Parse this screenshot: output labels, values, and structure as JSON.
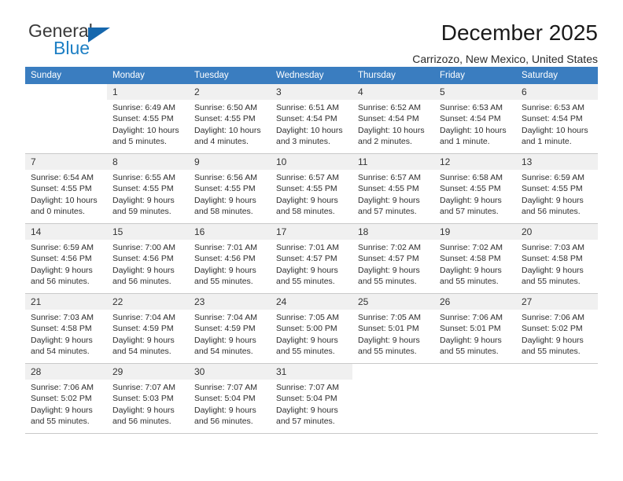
{
  "brand": {
    "name_top": "General",
    "name_bottom": "Blue",
    "triangle_color": "#1567ad",
    "blue_color": "#1d7fc4"
  },
  "header": {
    "title": "December 2025",
    "subtitle": "Carrizozo, New Mexico, United States"
  },
  "theme": {
    "header_row_bg": "#3a7dc0",
    "header_row_text": "#ffffff",
    "daynum_bg": "#f0f0f0",
    "cell_border": "#c9c9c9"
  },
  "weekdays": [
    "Sunday",
    "Monday",
    "Tuesday",
    "Wednesday",
    "Thursday",
    "Friday",
    "Saturday"
  ],
  "labels": {
    "sunrise_prefix": "Sunrise:",
    "sunset_prefix": "Sunset:",
    "daylight_prefix": "Daylight:"
  },
  "weeks": [
    [
      {
        "day": "",
        "sunrise": "",
        "sunset": "",
        "daylight_line1": "",
        "daylight_line2": ""
      },
      {
        "day": "1",
        "sunrise": "Sunrise: 6:49 AM",
        "sunset": "Sunset: 4:55 PM",
        "daylight_line1": "Daylight: 10 hours",
        "daylight_line2": "and 5 minutes."
      },
      {
        "day": "2",
        "sunrise": "Sunrise: 6:50 AM",
        "sunset": "Sunset: 4:55 PM",
        "daylight_line1": "Daylight: 10 hours",
        "daylight_line2": "and 4 minutes."
      },
      {
        "day": "3",
        "sunrise": "Sunrise: 6:51 AM",
        "sunset": "Sunset: 4:54 PM",
        "daylight_line1": "Daylight: 10 hours",
        "daylight_line2": "and 3 minutes."
      },
      {
        "day": "4",
        "sunrise": "Sunrise: 6:52 AM",
        "sunset": "Sunset: 4:54 PM",
        "daylight_line1": "Daylight: 10 hours",
        "daylight_line2": "and 2 minutes."
      },
      {
        "day": "5",
        "sunrise": "Sunrise: 6:53 AM",
        "sunset": "Sunset: 4:54 PM",
        "daylight_line1": "Daylight: 10 hours",
        "daylight_line2": "and 1 minute."
      },
      {
        "day": "6",
        "sunrise": "Sunrise: 6:53 AM",
        "sunset": "Sunset: 4:54 PM",
        "daylight_line1": "Daylight: 10 hours",
        "daylight_line2": "and 1 minute."
      }
    ],
    [
      {
        "day": "7",
        "sunrise": "Sunrise: 6:54 AM",
        "sunset": "Sunset: 4:55 PM",
        "daylight_line1": "Daylight: 10 hours",
        "daylight_line2": "and 0 minutes."
      },
      {
        "day": "8",
        "sunrise": "Sunrise: 6:55 AM",
        "sunset": "Sunset: 4:55 PM",
        "daylight_line1": "Daylight: 9 hours",
        "daylight_line2": "and 59 minutes."
      },
      {
        "day": "9",
        "sunrise": "Sunrise: 6:56 AM",
        "sunset": "Sunset: 4:55 PM",
        "daylight_line1": "Daylight: 9 hours",
        "daylight_line2": "and 58 minutes."
      },
      {
        "day": "10",
        "sunrise": "Sunrise: 6:57 AM",
        "sunset": "Sunset: 4:55 PM",
        "daylight_line1": "Daylight: 9 hours",
        "daylight_line2": "and 58 minutes."
      },
      {
        "day": "11",
        "sunrise": "Sunrise: 6:57 AM",
        "sunset": "Sunset: 4:55 PM",
        "daylight_line1": "Daylight: 9 hours",
        "daylight_line2": "and 57 minutes."
      },
      {
        "day": "12",
        "sunrise": "Sunrise: 6:58 AM",
        "sunset": "Sunset: 4:55 PM",
        "daylight_line1": "Daylight: 9 hours",
        "daylight_line2": "and 57 minutes."
      },
      {
        "day": "13",
        "sunrise": "Sunrise: 6:59 AM",
        "sunset": "Sunset: 4:55 PM",
        "daylight_line1": "Daylight: 9 hours",
        "daylight_line2": "and 56 minutes."
      }
    ],
    [
      {
        "day": "14",
        "sunrise": "Sunrise: 6:59 AM",
        "sunset": "Sunset: 4:56 PM",
        "daylight_line1": "Daylight: 9 hours",
        "daylight_line2": "and 56 minutes."
      },
      {
        "day": "15",
        "sunrise": "Sunrise: 7:00 AM",
        "sunset": "Sunset: 4:56 PM",
        "daylight_line1": "Daylight: 9 hours",
        "daylight_line2": "and 56 minutes."
      },
      {
        "day": "16",
        "sunrise": "Sunrise: 7:01 AM",
        "sunset": "Sunset: 4:56 PM",
        "daylight_line1": "Daylight: 9 hours",
        "daylight_line2": "and 55 minutes."
      },
      {
        "day": "17",
        "sunrise": "Sunrise: 7:01 AM",
        "sunset": "Sunset: 4:57 PM",
        "daylight_line1": "Daylight: 9 hours",
        "daylight_line2": "and 55 minutes."
      },
      {
        "day": "18",
        "sunrise": "Sunrise: 7:02 AM",
        "sunset": "Sunset: 4:57 PM",
        "daylight_line1": "Daylight: 9 hours",
        "daylight_line2": "and 55 minutes."
      },
      {
        "day": "19",
        "sunrise": "Sunrise: 7:02 AM",
        "sunset": "Sunset: 4:58 PM",
        "daylight_line1": "Daylight: 9 hours",
        "daylight_line2": "and 55 minutes."
      },
      {
        "day": "20",
        "sunrise": "Sunrise: 7:03 AM",
        "sunset": "Sunset: 4:58 PM",
        "daylight_line1": "Daylight: 9 hours",
        "daylight_line2": "and 55 minutes."
      }
    ],
    [
      {
        "day": "21",
        "sunrise": "Sunrise: 7:03 AM",
        "sunset": "Sunset: 4:58 PM",
        "daylight_line1": "Daylight: 9 hours",
        "daylight_line2": "and 54 minutes."
      },
      {
        "day": "22",
        "sunrise": "Sunrise: 7:04 AM",
        "sunset": "Sunset: 4:59 PM",
        "daylight_line1": "Daylight: 9 hours",
        "daylight_line2": "and 54 minutes."
      },
      {
        "day": "23",
        "sunrise": "Sunrise: 7:04 AM",
        "sunset": "Sunset: 4:59 PM",
        "daylight_line1": "Daylight: 9 hours",
        "daylight_line2": "and 54 minutes."
      },
      {
        "day": "24",
        "sunrise": "Sunrise: 7:05 AM",
        "sunset": "Sunset: 5:00 PM",
        "daylight_line1": "Daylight: 9 hours",
        "daylight_line2": "and 55 minutes."
      },
      {
        "day": "25",
        "sunrise": "Sunrise: 7:05 AM",
        "sunset": "Sunset: 5:01 PM",
        "daylight_line1": "Daylight: 9 hours",
        "daylight_line2": "and 55 minutes."
      },
      {
        "day": "26",
        "sunrise": "Sunrise: 7:06 AM",
        "sunset": "Sunset: 5:01 PM",
        "daylight_line1": "Daylight: 9 hours",
        "daylight_line2": "and 55 minutes."
      },
      {
        "day": "27",
        "sunrise": "Sunrise: 7:06 AM",
        "sunset": "Sunset: 5:02 PM",
        "daylight_line1": "Daylight: 9 hours",
        "daylight_line2": "and 55 minutes."
      }
    ],
    [
      {
        "day": "28",
        "sunrise": "Sunrise: 7:06 AM",
        "sunset": "Sunset: 5:02 PM",
        "daylight_line1": "Daylight: 9 hours",
        "daylight_line2": "and 55 minutes."
      },
      {
        "day": "29",
        "sunrise": "Sunrise: 7:07 AM",
        "sunset": "Sunset: 5:03 PM",
        "daylight_line1": "Daylight: 9 hours",
        "daylight_line2": "and 56 minutes."
      },
      {
        "day": "30",
        "sunrise": "Sunrise: 7:07 AM",
        "sunset": "Sunset: 5:04 PM",
        "daylight_line1": "Daylight: 9 hours",
        "daylight_line2": "and 56 minutes."
      },
      {
        "day": "31",
        "sunrise": "Sunrise: 7:07 AM",
        "sunset": "Sunset: 5:04 PM",
        "daylight_line1": "Daylight: 9 hours",
        "daylight_line2": "and 57 minutes."
      },
      {
        "day": "",
        "sunrise": "",
        "sunset": "",
        "daylight_line1": "",
        "daylight_line2": ""
      },
      {
        "day": "",
        "sunrise": "",
        "sunset": "",
        "daylight_line1": "",
        "daylight_line2": ""
      },
      {
        "day": "",
        "sunrise": "",
        "sunset": "",
        "daylight_line1": "",
        "daylight_line2": ""
      }
    ]
  ]
}
